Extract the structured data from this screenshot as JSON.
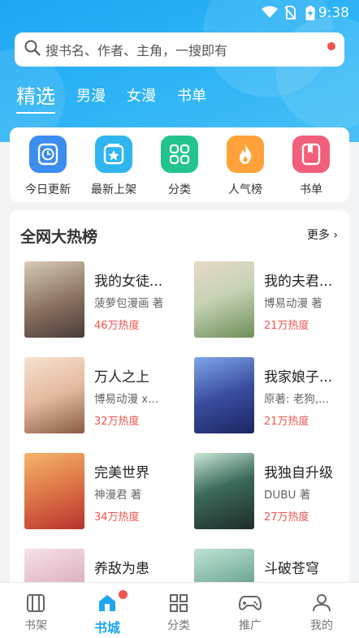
{
  "status": {
    "time": "9:38"
  },
  "search": {
    "placeholder": "搜书名、作者、主角，一搜即有"
  },
  "tabs": [
    {
      "label": "精选",
      "active": true
    },
    {
      "label": "男漫"
    },
    {
      "label": "女漫"
    },
    {
      "label": "书单"
    }
  ],
  "quick_links": [
    {
      "label": "今日更新",
      "icon": "clock-icon",
      "color": "#3b8df0"
    },
    {
      "label": "最新上架",
      "icon": "star-box-icon",
      "color": "#2fb6f0"
    },
    {
      "label": "分类",
      "icon": "category-icon",
      "color": "#23c38e"
    },
    {
      "label": "人气榜",
      "icon": "flame-icon",
      "color": "#ffa23b"
    },
    {
      "label": "书单",
      "icon": "bookmark-icon",
      "color": "#f25f7a"
    }
  ],
  "ranking": {
    "title": "全网大热榜",
    "more_label": "更多",
    "books": [
      {
        "name": "我的女徒...",
        "author": "菠萝包漫画 著",
        "heat": "46万热度",
        "cover_colors": [
          "#d7cbb8",
          "#4a3b3a"
        ]
      },
      {
        "name": "我的夫君...",
        "author": "博易动漫 著",
        "heat": "21万热度",
        "cover_colors": [
          "#c6d3b5",
          "#6f8f5a"
        ]
      },
      {
        "name": "万人之上",
        "author": "博易动漫 x...",
        "heat": "32万热度",
        "cover_colors": [
          "#f1d7c5",
          "#b58c6a"
        ]
      },
      {
        "name": "我家娘子...",
        "author": "原著: 老狗,...",
        "heat": "21万热度",
        "cover_colors": [
          "#2b3a86",
          "#7fa6e8"
        ]
      },
      {
        "name": "完美世界",
        "author": "神漫君 著",
        "heat": "34万热度",
        "cover_colors": [
          "#f4b56a",
          "#b8332d"
        ]
      },
      {
        "name": "我独自升级",
        "author": "DUBU 著",
        "heat": "27万热度",
        "cover_colors": [
          "#1f2b2a",
          "#5fbf8f"
        ]
      },
      {
        "name": "养敌为患",
        "author": "",
        "heat": "",
        "cover_colors": [
          "#efd0d8",
          "#b58a9a"
        ]
      },
      {
        "name": "斗破苍穹",
        "author": "",
        "heat": "",
        "cover_colors": [
          "#7fb3a1",
          "#2c5e58"
        ]
      }
    ]
  },
  "bottom_nav": [
    {
      "label": "书架",
      "icon": "bookshelf-icon"
    },
    {
      "label": "书城",
      "icon": "bookstore-icon",
      "active": true,
      "badge": true
    },
    {
      "label": "分类",
      "icon": "grid-icon"
    },
    {
      "label": "推广",
      "icon": "gamepad-icon"
    },
    {
      "label": "我的",
      "icon": "profile-icon"
    }
  ]
}
